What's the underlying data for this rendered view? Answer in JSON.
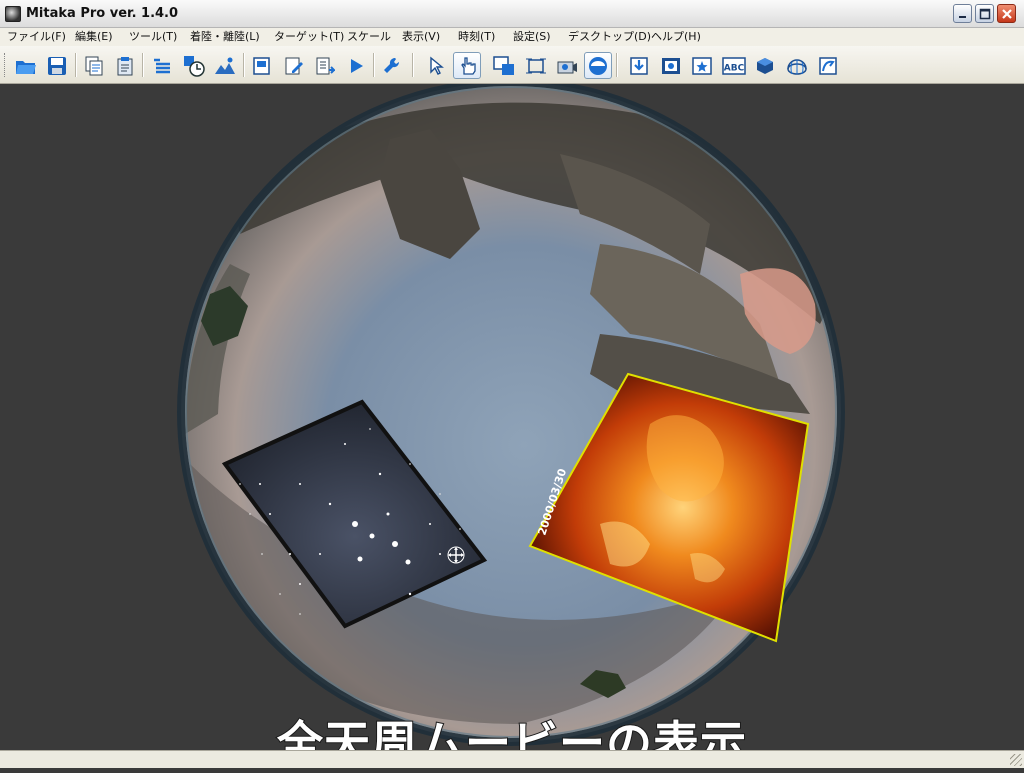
{
  "window": {
    "title": "Mitaka Pro ver. 1.4.0",
    "controls": [
      "minimize",
      "maximize",
      "close"
    ]
  },
  "menu": [
    {
      "label": "ファイル(F)"
    },
    {
      "label": "編集(E)"
    },
    {
      "label": "ツール(T)"
    },
    {
      "label": "着陸・離陸(L)"
    },
    {
      "label": "ターゲット(T)"
    },
    {
      "label": "スケール"
    },
    {
      "label": "表示(V)"
    },
    {
      "label": "時刻(T)"
    },
    {
      "label": "設定(S)"
    },
    {
      "label": "デスクトップ(D)"
    },
    {
      "label": "ヘルプ(H)"
    }
  ],
  "toolbar": {
    "buttons": [
      {
        "name": "open-icon"
      },
      {
        "name": "save-icon"
      },
      {
        "name": "copy-icon"
      },
      {
        "name": "paste-icon"
      },
      {
        "name": "list-icon"
      },
      {
        "name": "time-icon"
      },
      {
        "name": "landscape-icon"
      },
      {
        "name": "document-icon"
      },
      {
        "name": "edit-icon"
      },
      {
        "name": "export-icon"
      },
      {
        "name": "play-icon"
      },
      {
        "name": "wrench-icon"
      },
      {
        "name": "pointer-icon"
      },
      {
        "name": "hand-icon",
        "active": true
      },
      {
        "name": "window-move-icon"
      },
      {
        "name": "window-resize-icon"
      },
      {
        "name": "camera-icon"
      },
      {
        "name": "dome-view-icon",
        "active": true
      },
      {
        "name": "download-icon"
      },
      {
        "name": "film-icon"
      },
      {
        "name": "star-image-icon"
      },
      {
        "name": "abc-text-icon",
        "text": "ABC"
      },
      {
        "name": "cube-icon"
      },
      {
        "name": "globe-grid-icon"
      },
      {
        "name": "tool-curve-icon"
      }
    ]
  },
  "viewport": {
    "movie_date_label": "2000/03/30",
    "caption": "全天周ムービーの表示",
    "colors": {
      "background": "#3a3a3a",
      "sky": "#7a8ea6",
      "sun_panel_border": "#e0e000"
    }
  }
}
